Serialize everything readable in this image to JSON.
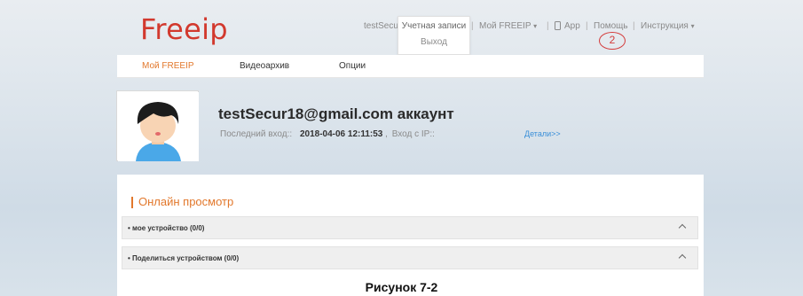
{
  "header": {
    "logo": "Freeip",
    "user_label": "testSecu",
    "my_freeip": "Мой FREEIP",
    "app": "App",
    "help": "Помощь",
    "instruction": "Инструкция",
    "dropdown": {
      "item1": "Учетная записи",
      "item2": "Выход"
    },
    "annotation": "2"
  },
  "tabs": [
    {
      "label": "Мой FREEIP",
      "active": true
    },
    {
      "label": "Видеоархив",
      "active": false
    },
    {
      "label": "Опции",
      "active": false
    }
  ],
  "account": {
    "title": "testSecur18@gmail.com аккаунт",
    "last_login_label": "Последний вход::",
    "last_login_value": "2018-04-06 12:11:53",
    "login_ip_label": "Вход с IP::",
    "details_link": "Детали>>"
  },
  "online": {
    "section_title": "Онлайн просмотр",
    "rows": [
      {
        "label": "• мое устройство (0/0)"
      },
      {
        "label": "• Поделиться устройством (0/0)"
      }
    ]
  },
  "caption": "Рисунок 7-2",
  "colors": {
    "logo": "#d2392e",
    "accent": "#e2782c",
    "link": "#3a8fd8",
    "annotation": "#d43a3a"
  }
}
